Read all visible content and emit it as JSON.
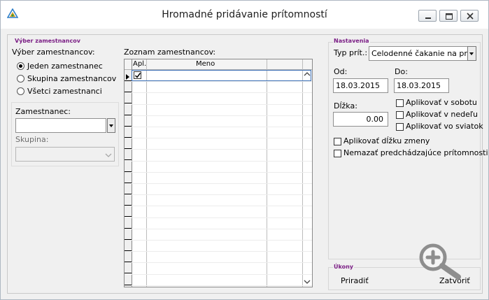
{
  "window": {
    "title": "Hromadné pridávanie prítomností"
  },
  "vyber": {
    "group_title": "Výber zamestnancov",
    "label": "Výber zamestnancov:",
    "options": [
      {
        "label": "Jeden zamestnanec",
        "selected": true
      },
      {
        "label": "Skupina zamestnancov",
        "selected": false
      },
      {
        "label": "Všetci zamestnanci",
        "selected": false
      }
    ],
    "zamestnanec_label": "Zamestnanec:",
    "zamestnanec_value": "",
    "skupina_label": "Skupina:",
    "skupina_value": ""
  },
  "zoznam": {
    "label": "Zoznam zamestnancov:",
    "columns": [
      "Apl.",
      "Meno"
    ],
    "rows": [
      {
        "apl": true,
        "meno": ""
      }
    ]
  },
  "nastavenia": {
    "group_title": "Nastavenia",
    "typ_label": "Typ prít.:",
    "typ_value": "Celodenné čakanie na prá",
    "od_label": "Od:",
    "od_value": "18.03.2015",
    "do_label": "Do:",
    "do_value": "18.03.2015",
    "dlzka_label": "Dĺžka:",
    "dlzka_value": "0.00",
    "sobota_label": "Aplikovať v sobotu",
    "nedela_label": "Aplikovať v nedeľu",
    "sviatok_label": "Aplikovať vo sviatok",
    "dlzku_label": "Aplikovať dĺžku zmeny",
    "nemazat_label": "Nemazať predchádzajúce prítomnosti"
  },
  "ukony": {
    "group_title": "Úkony",
    "priradit": "Priradiť",
    "zatvorit": "Zatvoriť"
  },
  "colors": {
    "group_title": "#7b1e85",
    "selection_border": "#3b6fb6"
  }
}
